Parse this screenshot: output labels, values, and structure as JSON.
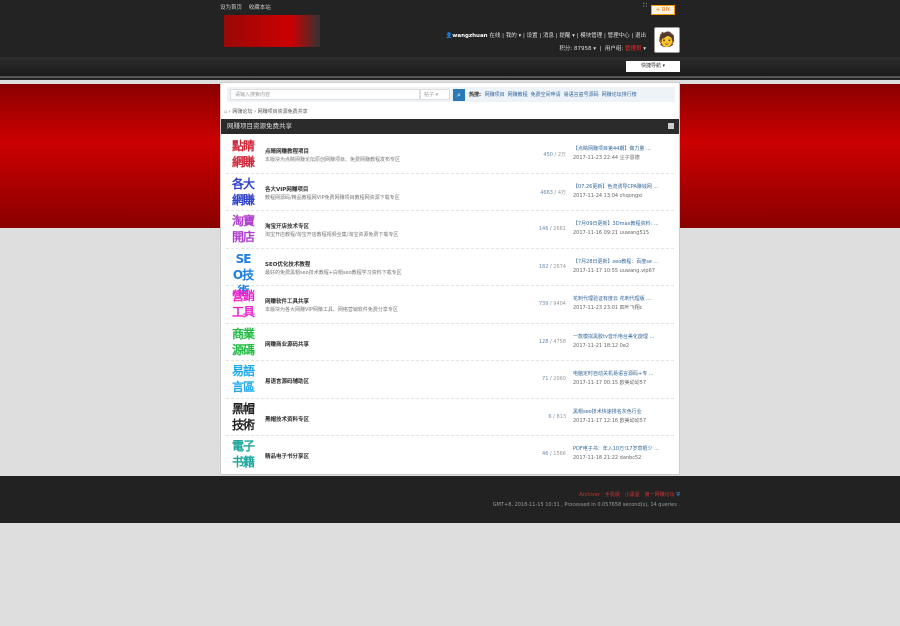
{
  "topbar": {
    "links": [
      "设为首页",
      "收藏本站"
    ],
    "diy": "+ DIY"
  },
  "user": {
    "name": "wangzhuan",
    "status": "在线",
    "menu": [
      "我的",
      "设置",
      "消息",
      "提醒",
      "模块管理",
      "管理中心",
      "退出"
    ],
    "points": "积分: 87958",
    "group_label": "用户组:",
    "group": "管理员"
  },
  "quick_nav": "快捷导航",
  "search": {
    "placeholder": "请输入搜索内容",
    "type": "帖子",
    "hot_label": "热搜:",
    "hot": [
      "网赚项目",
      "网赚教程",
      "免费空间申请",
      "易语言盗号源码",
      "网赚论坛排行榜"
    ]
  },
  "breadcrumb": [
    "网赚论坛",
    "网赚项目资源免费共享"
  ],
  "section_title": "网赚项目资源免费共享",
  "forums": [
    {
      "icon": "點睛網賺",
      "color": "#d0283a",
      "name": "点睛网赚教程项目",
      "desc": "本版块为点睛网赚论坛原创网赚项目、免费网赚教程发布专区",
      "threads": "450",
      "posts": "2万",
      "last": "【点睛网赚项目第44期】做力量 ...",
      "meta": "2017-11-23 22:44 尘子恩德"
    },
    {
      "icon": "各大網賺",
      "color": "#3344cc",
      "name": "各大VIP网赚项目",
      "desc": "教程网源码/精品教程网VIP免费网赚项目教程网资源下载专区",
      "threads": "4663",
      "posts": "4万",
      "last": "【07.26更新】色流诱导CPA赚钱网 ...",
      "meta": "2017-11-24 13:04 chqongxi"
    },
    {
      "icon": "淘寶開店",
      "color": "#b13fcf",
      "name": "淘宝开店技术专区",
      "desc": "淘宝开店教程/淘宝开店教程视频全集/淘宝资源免费下载专区",
      "threads": "146",
      "posts": "2661",
      "last": "【7月09日更新】3Dmax教程资料: ...",
      "meta": "2017-11-16 09:21 uuwang515"
    },
    {
      "icon": "SEO技術",
      "color": "#1e7ee0",
      "name": "SEO优化技术教程",
      "desc": "最好的免费黑帽seo技术教程+白帽seo教程学习资料下载专区",
      "threads": "182",
      "posts": "2674",
      "last": "【7月28日更新】seo教程：百度se ...",
      "meta": "2017-11-17 10:55 uuwang.vip67"
    },
    {
      "icon": "營銷工具",
      "color": "#ee22cc",
      "name": "网赚软件工具共享",
      "desc": "本版块为各大网赚VIP网赚工具、网络营销软件免费分享专区",
      "threads": "739",
      "posts": "9404",
      "last": "花刺代理验证有度云 花刺代理版 ...",
      "meta": "2017-11-23 23:01 四叶飞翔c"
    },
    {
      "icon": "商業源碼",
      "color": "#22bb44",
      "name": "网赚商业源码共享",
      "desc": "",
      "threads": "128",
      "posts": "4758",
      "last": "一款模拟黑胶tv音乐电台美化旋理 ...",
      "meta": "2017-11-21 18:12 0e2"
    },
    {
      "icon": "易語言區",
      "color": "#22aaee",
      "name": "易语言源码辅助区",
      "desc": "",
      "threads": "71",
      "posts": "2060",
      "last": "电脑定时自动关机易语言源码+专 ...",
      "meta": "2017-11-17 00:15 欧美幼幼57"
    },
    {
      "icon": "黑帽技術",
      "color": "#222222",
      "name": "黑帽技术资料专区",
      "desc": "",
      "threads": "6",
      "posts": "813",
      "last": "黑帽seo技术快速排名灰色行业",
      "meta": "2017-11-17 12:16 欧美幼幼57"
    },
    {
      "icon": "電子书籍",
      "color": "#1aa59a",
      "name": "精品电子书分享区",
      "desc": "",
      "threads": "46",
      "posts": "1566",
      "last": "PDF电子书：年入10万!17岁草根少 ...",
      "meta": "2017-11-18 21:22 danbc52"
    }
  ],
  "footer": {
    "links": [
      "Archiver",
      "手机版",
      "小黑屋",
      "第一网赚论坛"
    ],
    "info": "GMT+8, 2018-11-15 10:31 , Processed in 0.057658 second(s), 14 queries ."
  }
}
